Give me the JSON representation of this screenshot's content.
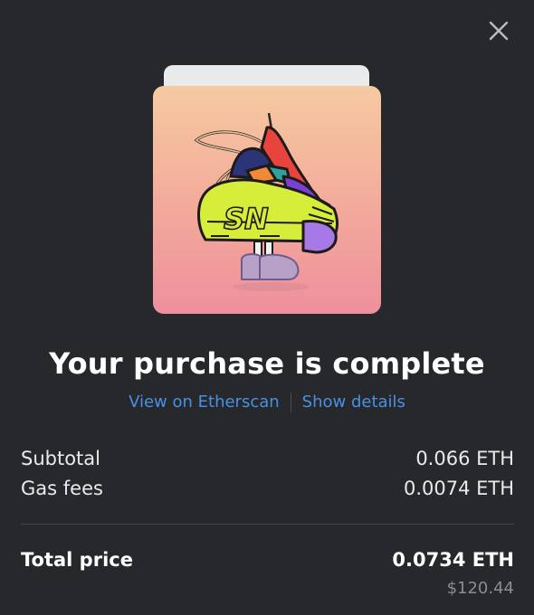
{
  "dialog": {
    "close_icon": "close-icon",
    "headline": "Your purchase is complete",
    "artwork_icon": "sneaker-nft-artwork",
    "artwork_gradient": [
      "#f6caa0",
      "#ef8f9d"
    ]
  },
  "links": {
    "etherscan": "View on Etherscan",
    "details": "Show details",
    "color": "#4a90e2"
  },
  "summary": {
    "subtotal_label": "Subtotal",
    "subtotal_value": "0.066 ETH",
    "gas_label": "Gas fees",
    "gas_value": "0.0074 ETH",
    "total_label": "Total price",
    "total_value": "0.0734 ETH",
    "total_usd": "$120.44"
  },
  "colors": {
    "background": "#26282c",
    "text": "#ffffff",
    "muted": "#8a8d92"
  }
}
